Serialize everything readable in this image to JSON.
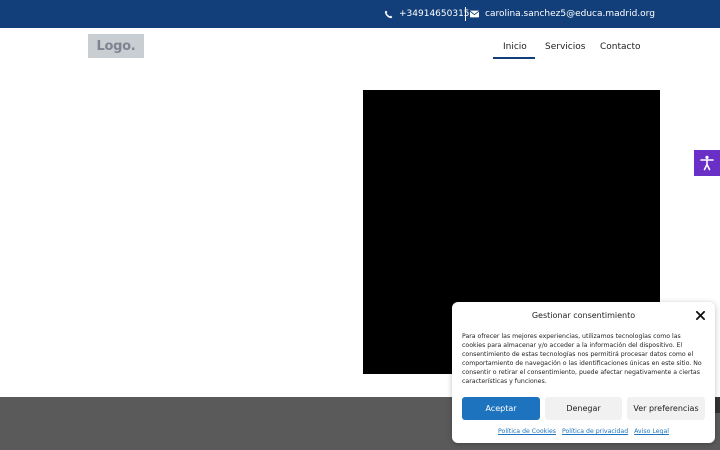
{
  "topbar": {
    "phone": "+34914650315",
    "email": "carolina.sanchez5@educa.madrid.org",
    "icons": [
      "phone-icon",
      "envelope-icon"
    ],
    "background": "#123f7a"
  },
  "header": {
    "logo": "Logo.",
    "nav": [
      {
        "label": "Inicio",
        "active": true
      },
      {
        "label": "Servicios",
        "active": false
      },
      {
        "label": "Contacto",
        "active": false
      }
    ]
  },
  "accessibility": {
    "icon": "accessibility-icon",
    "color": "#6a2fc7"
  },
  "consent": {
    "title": "Gestionar consentimiento",
    "body": "Para ofrecer las mejores experiencias, utilizamos tecnologías como las cookies para almacenar y/o acceder a la información del dispositivo. El consentimiento de estas tecnologías nos permitirá procesar datos como el comportamiento de navegación o las identificaciones únicas en este sitio. No consentir o retirar el consentimiento, puede afectar negativamente a ciertas características y funciones.",
    "buttons": {
      "accept": "Aceptar",
      "deny": "Denegar",
      "preferences": "Ver preferencias"
    },
    "links": [
      "Política de Cookies",
      "Política de privacidad",
      "Aviso Legal"
    ],
    "accent": "#1e73be"
  }
}
